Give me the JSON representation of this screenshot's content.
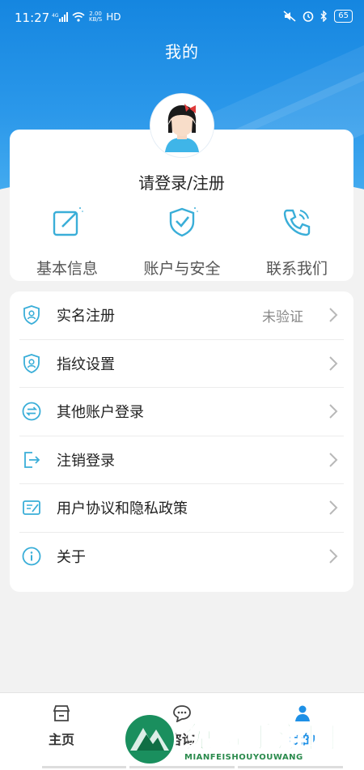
{
  "status_bar": {
    "time": "11:27",
    "network": "4G",
    "speed_value": "2.00",
    "speed_unit": "KB/S",
    "hd": "HD",
    "battery": "65"
  },
  "header": {
    "title": "我的"
  },
  "profile": {
    "login_label": "请登录/注册",
    "quick_actions": [
      {
        "label": "基本信息",
        "icon": "edit-icon"
      },
      {
        "label": "账户与安全",
        "icon": "shield-check-icon"
      },
      {
        "label": "联系我们",
        "icon": "phone-icon"
      }
    ]
  },
  "menu": {
    "items": [
      {
        "label": "实名注册",
        "value": "未验证",
        "icon": "shield-user-icon"
      },
      {
        "label": "指纹设置",
        "value": "",
        "icon": "shield-user-icon"
      },
      {
        "label": "其他账户登录",
        "value": "",
        "icon": "swap-icon"
      },
      {
        "label": "注销登录",
        "value": "",
        "icon": "logout-icon"
      },
      {
        "label": "用户协议和隐私政策",
        "value": "",
        "icon": "agreement-icon"
      },
      {
        "label": "关于",
        "value": "",
        "icon": "info-icon"
      }
    ]
  },
  "tabbar": {
    "tabs": [
      {
        "label": "主页",
        "icon": "home-icon"
      },
      {
        "label": "咨询",
        "icon": "chat-icon"
      },
      {
        "label": "我的",
        "icon": "user-icon"
      }
    ]
  },
  "watermark": {
    "text": "免费手游网",
    "subtext": "MIANFEISHOUYOUWANG"
  },
  "colors": {
    "accent": "#1e90e6",
    "icon": "#3aaed8"
  }
}
